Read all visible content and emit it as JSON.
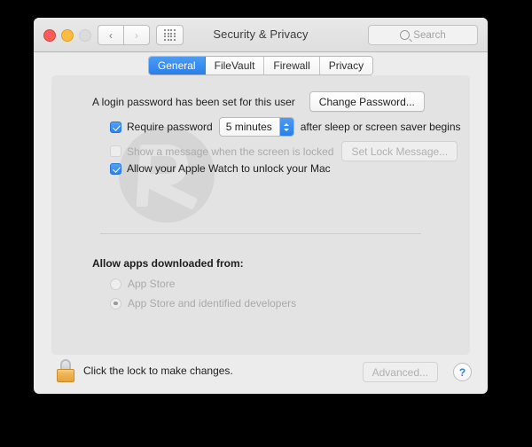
{
  "window": {
    "title": "Security & Privacy",
    "traffic_lights": [
      {
        "name": "close",
        "color": "#fc5b57"
      },
      {
        "name": "minimize",
        "color": "#fdbc40"
      },
      {
        "name": "zoom",
        "color": "#dcdcdc"
      }
    ],
    "nav": {
      "back_icon": "chevron-left-icon",
      "forward_icon": "chevron-right-icon",
      "show_all_icon": "grid-dots-icon"
    },
    "search": {
      "placeholder": "Search",
      "icon": "search-icon"
    }
  },
  "tabs": [
    {
      "label": "General",
      "active": true
    },
    {
      "label": "FileVault",
      "active": false
    },
    {
      "label": "Firewall",
      "active": false
    },
    {
      "label": "Privacy",
      "active": false
    }
  ],
  "general": {
    "login_password_text": "A login password has been set for this user",
    "change_password_label": "Change Password...",
    "require_password": {
      "checked": true,
      "label": "Require password",
      "delay_value": "5 minutes",
      "suffix": "after sleep or screen saver begins"
    },
    "show_message": {
      "checked": false,
      "enabled": false,
      "label": "Show a message when the screen is locked",
      "button_label": "Set Lock Message..."
    },
    "apple_watch": {
      "checked": true,
      "label": "Allow your Apple Watch to unlock your Mac"
    },
    "allow_apps": {
      "heading": "Allow apps downloaded from:",
      "options": [
        {
          "label": "App Store",
          "selected": false
        },
        {
          "label": "App Store and identified developers",
          "selected": true
        }
      ]
    }
  },
  "bottom": {
    "lock_icon": "lock-closed-icon",
    "lock_text": "Click the lock to make changes.",
    "advanced_label": "Advanced...",
    "help_label": "?"
  },
  "colors": {
    "accent_blue": "#2a7fe8",
    "lock_gold": "#e6a23c",
    "window_bg": "#ececec",
    "panel_bg": "#e3e3e3"
  }
}
